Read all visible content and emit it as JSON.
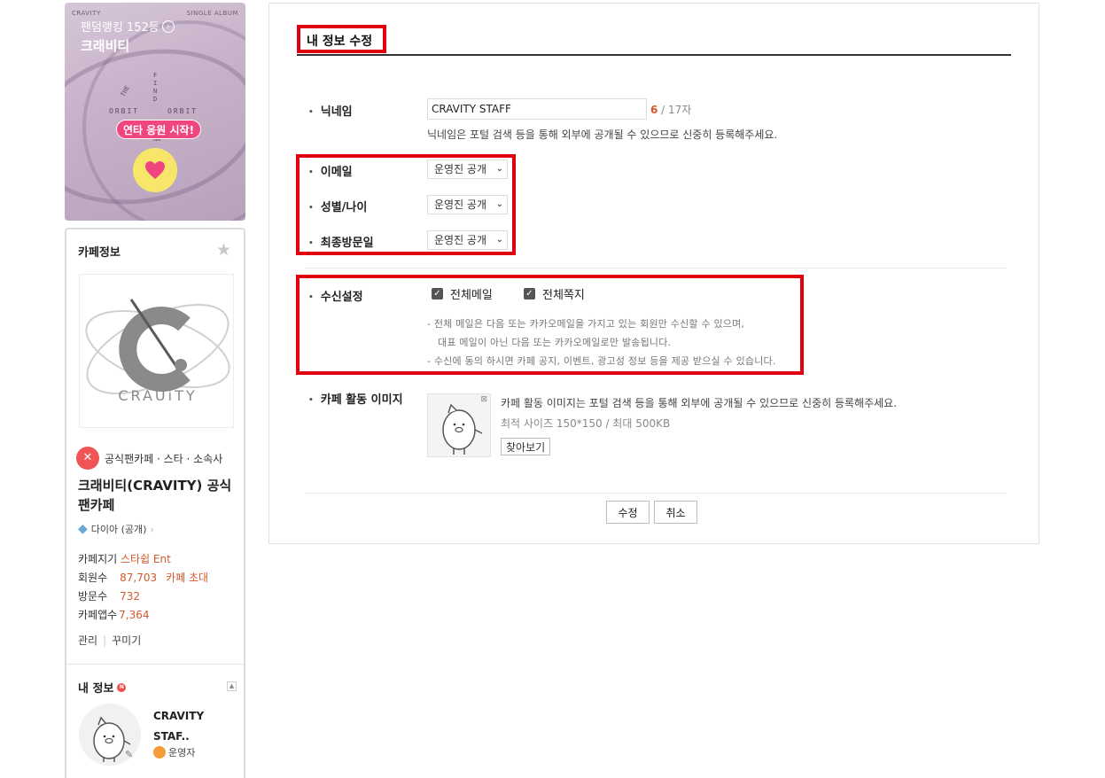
{
  "banner": {
    "label_left": "CRAVITY",
    "label_right": "SINGLE ALBUM",
    "rank_text": "팬덤랭킹 152등",
    "artist": "크래비티",
    "art_the": "THE",
    "art_find": "FIND",
    "art_orbit_left": "ORBIT",
    "art_orbit_right": "ORBIT",
    "art_na": "NA",
    "cheer_button": "연타 응원 시작!"
  },
  "cafe_info": {
    "heading": "카페정보",
    "logo_text": "CRAUiTY",
    "badge_text": "공식팬카페 · 스타 · 소속사",
    "badge_icon_glyph": "✕",
    "cafe_name": "크래비티(CRAVITY) 공식팬카페",
    "grade": "다이아 (공개)",
    "stats": {
      "keeper_label": "카페지기",
      "keeper_value": "스타쉽 Ent",
      "members_label": "회원수",
      "members_value": "87,703",
      "invite_link": "카페 초대",
      "visits_label": "방문수",
      "visits_value": "732",
      "app_label": "카페앱수",
      "app_value": "7,364"
    },
    "manage": "관리",
    "decorate": "꾸미기"
  },
  "my_info": {
    "heading": "내 정보",
    "new_badge": "N",
    "name": "CRAVITY STAF..",
    "role": "운영자"
  },
  "form": {
    "title": "내 정보 수정",
    "nickname": {
      "label": "닉네임",
      "value": "CRAVITY STAFF",
      "count_current": "6",
      "count_rest": " / 17자",
      "help": "닉네임은 포털 검색 등을 통해 외부에 공개될 수 있으므로 신중히 등록해주세요."
    },
    "privacy": [
      {
        "label": "이메일",
        "value": "운영진 공개"
      },
      {
        "label": "성별/나이",
        "value": "운영진 공개"
      },
      {
        "label": "최종방문일",
        "value": "운영진 공개"
      }
    ],
    "receive": {
      "label": "수신설정",
      "all_mail": "전체메일",
      "all_note": "전체쪽지",
      "notes": [
        "- 전체 메일은 다음 또는 카카오메일을 가지고 있는 회원만 수신할 수 있으며,",
        "대표 메일이 아닌 다음 또는 카카오메일로만 발송됩니다.",
        "- 수신에 동의 하시면 카페 공지, 이벤트, 광고성 정보 등을 제공 받으실 수 있습니다."
      ]
    },
    "image": {
      "label": "카페 활동 이미지",
      "desc": "카페 활동 이미지는 포털 검색 등을 통해 외부에 공개될 수 있으므로 신중히 등록해주세요.",
      "size_note": "최적 사이즈 150*150 / 최대 500KB",
      "browse": "찾아보기"
    },
    "submit": "수정",
    "cancel": "취소"
  },
  "colors": {
    "highlight_red": "#e1000f",
    "accent_orange": "#d2592a",
    "cheer_pink": "#f0467f"
  }
}
